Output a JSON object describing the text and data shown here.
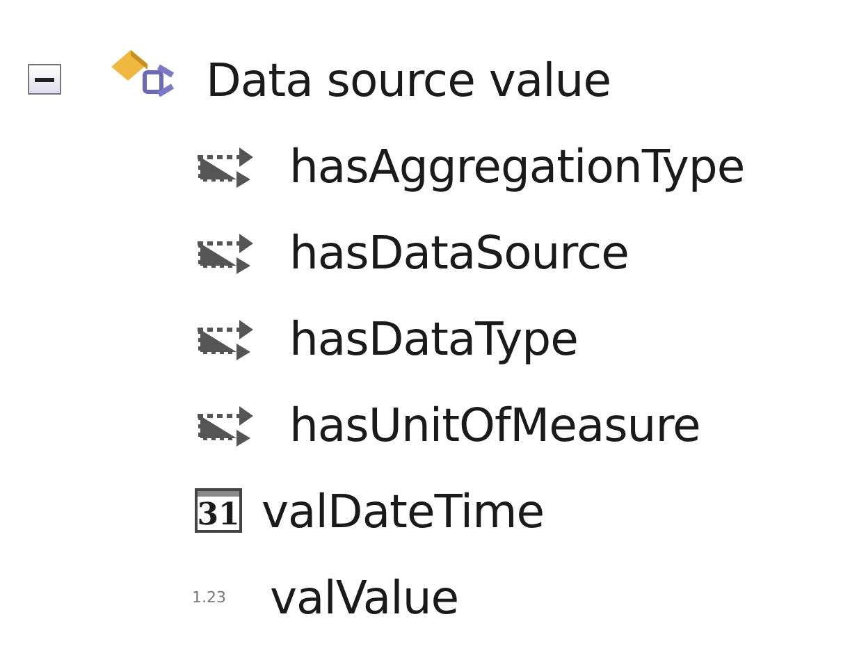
{
  "tree": {
    "label": "Data source value",
    "expanded": true,
    "children": [
      {
        "kind": "relation",
        "label": "hasAggregationType"
      },
      {
        "kind": "relation",
        "label": "hasDataSource"
      },
      {
        "kind": "relation",
        "label": "hasDataType"
      },
      {
        "kind": "relation",
        "label": "hasUnitOfMeasure"
      },
      {
        "kind": "date",
        "icon_text": "31",
        "label": "valDateTime"
      },
      {
        "kind": "number",
        "icon_text": "1.23",
        "label": "valValue"
      }
    ]
  }
}
